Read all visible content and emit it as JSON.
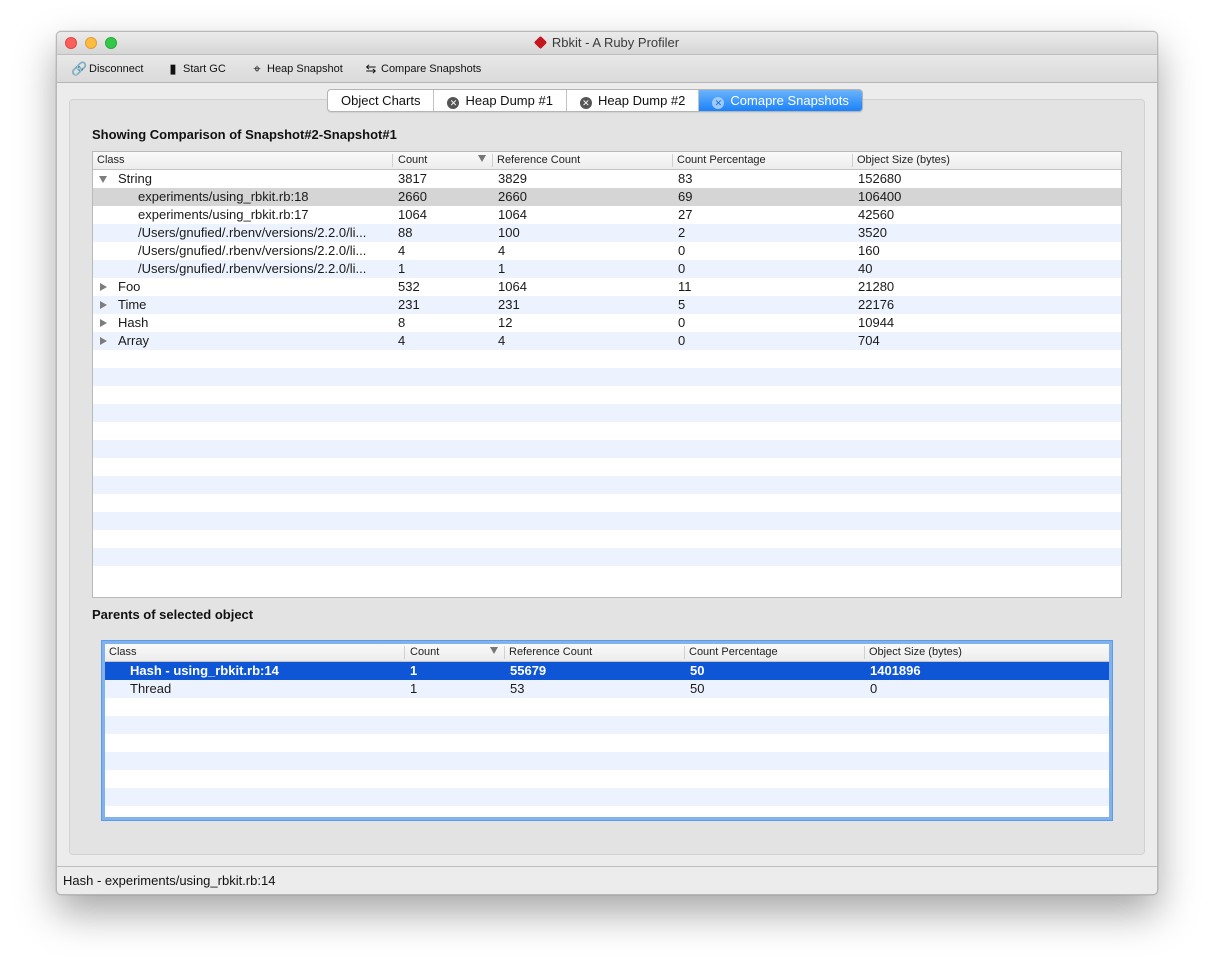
{
  "window": {
    "title": "Rbkit - A Ruby Profiler"
  },
  "toolbar": {
    "disconnect": "Disconnect",
    "start_gc": "Start GC",
    "heap_snapshot": "Heap Snapshot",
    "compare_snapshots": "Compare  Snapshots"
  },
  "tabs": [
    {
      "label": "Object Charts",
      "closable": false,
      "active": false
    },
    {
      "label": "Heap Dump #1",
      "closable": true,
      "active": false
    },
    {
      "label": "Heap Dump #2",
      "closable": true,
      "active": false
    },
    {
      "label": "Comapre Snapshots",
      "closable": true,
      "active": true
    }
  ],
  "comparison": {
    "title": "Showing Comparison of Snapshot#2-Snapshot#1",
    "columns": [
      "Class",
      "Count",
      "Reference Count",
      "Count Percentage",
      "Object Size (bytes)"
    ],
    "sorted_column": "Count",
    "rows": [
      {
        "name": "String",
        "level": 0,
        "expander": "expanded",
        "count": "3817",
        "ref_count": "3829",
        "pct": "83",
        "size": "152680",
        "selected": false
      },
      {
        "name": "experiments/using_rbkit.rb:18",
        "level": 1,
        "expander": "none",
        "count": "2660",
        "ref_count": "2660",
        "pct": "69",
        "size": "106400",
        "selected": true
      },
      {
        "name": "experiments/using_rbkit.rb:17",
        "level": 1,
        "expander": "none",
        "count": "1064",
        "ref_count": "1064",
        "pct": "27",
        "size": "42560",
        "selected": false
      },
      {
        "name": "/Users/gnufied/.rbenv/versions/2.2.0/li...",
        "level": 1,
        "expander": "none",
        "count": "88",
        "ref_count": "100",
        "pct": "2",
        "size": "3520",
        "selected": false
      },
      {
        "name": "/Users/gnufied/.rbenv/versions/2.2.0/li...",
        "level": 1,
        "expander": "none",
        "count": "4",
        "ref_count": "4",
        "pct": "0",
        "size": "160",
        "selected": false
      },
      {
        "name": "/Users/gnufied/.rbenv/versions/2.2.0/li...",
        "level": 1,
        "expander": "none",
        "count": "1",
        "ref_count": "1",
        "pct": "0",
        "size": "40",
        "selected": false
      },
      {
        "name": "Foo",
        "level": 0,
        "expander": "collapsed",
        "count": "532",
        "ref_count": "1064",
        "pct": "11",
        "size": "21280",
        "selected": false
      },
      {
        "name": "Time",
        "level": 0,
        "expander": "collapsed",
        "count": "231",
        "ref_count": "231",
        "pct": "5",
        "size": "22176",
        "selected": false
      },
      {
        "name": "Hash",
        "level": 0,
        "expander": "collapsed",
        "count": "8",
        "ref_count": "12",
        "pct": "0",
        "size": "10944",
        "selected": false
      },
      {
        "name": "Array",
        "level": 0,
        "expander": "collapsed",
        "count": "4",
        "ref_count": "4",
        "pct": "0",
        "size": "704",
        "selected": false
      }
    ]
  },
  "parents": {
    "title": "Parents of selected object",
    "columns": [
      "Class",
      "Count",
      "Reference Count",
      "Count Percentage",
      "Object Size (bytes)"
    ],
    "sorted_column": "Count",
    "rows": [
      {
        "name": "Hash - using_rbkit.rb:14",
        "count": "1",
        "ref_count": "55679",
        "pct": "50",
        "size": "1401896",
        "selected": true
      },
      {
        "name": "Thread",
        "count": "1",
        "ref_count": "53",
        "pct": "50",
        "size": "0",
        "selected": false
      }
    ]
  },
  "status": {
    "text": "Hash - experiments/using_rbkit.rb:14"
  }
}
